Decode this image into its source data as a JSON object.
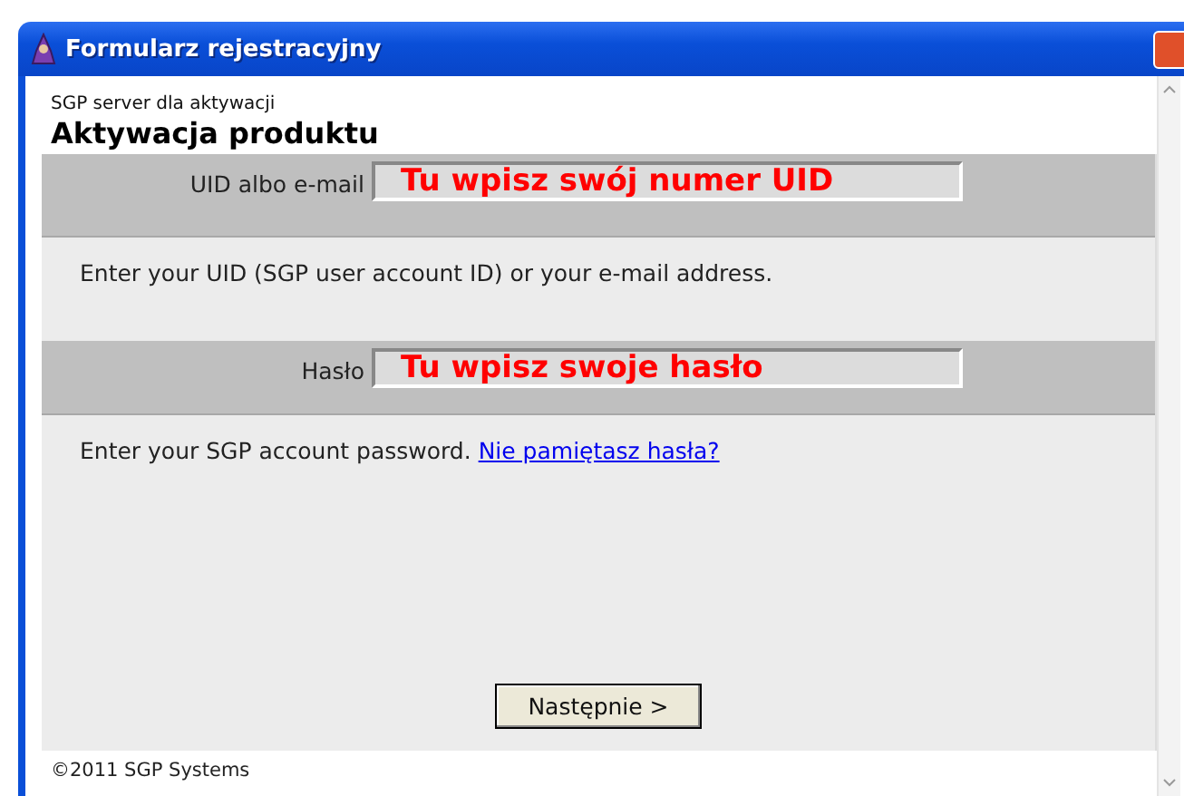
{
  "window": {
    "title": "Formularz rejestracyjny"
  },
  "header": {
    "subtitle": "SGP server dla aktywacji",
    "title": "Aktywacja produktu"
  },
  "fields": [
    {
      "label": "UID albo e-mail",
      "value": "Tu wpisz swój numer UID",
      "help": "Enter your UID (SGP user account ID) or your e-mail address."
    },
    {
      "label": "Hasło",
      "value": "Tu wpisz swoje hasło",
      "help": "Enter your SGP account password.",
      "link": "Nie pamiętasz hasła?"
    }
  ],
  "next_button": "Następnie >",
  "footer": "©2011 SGP Systems"
}
